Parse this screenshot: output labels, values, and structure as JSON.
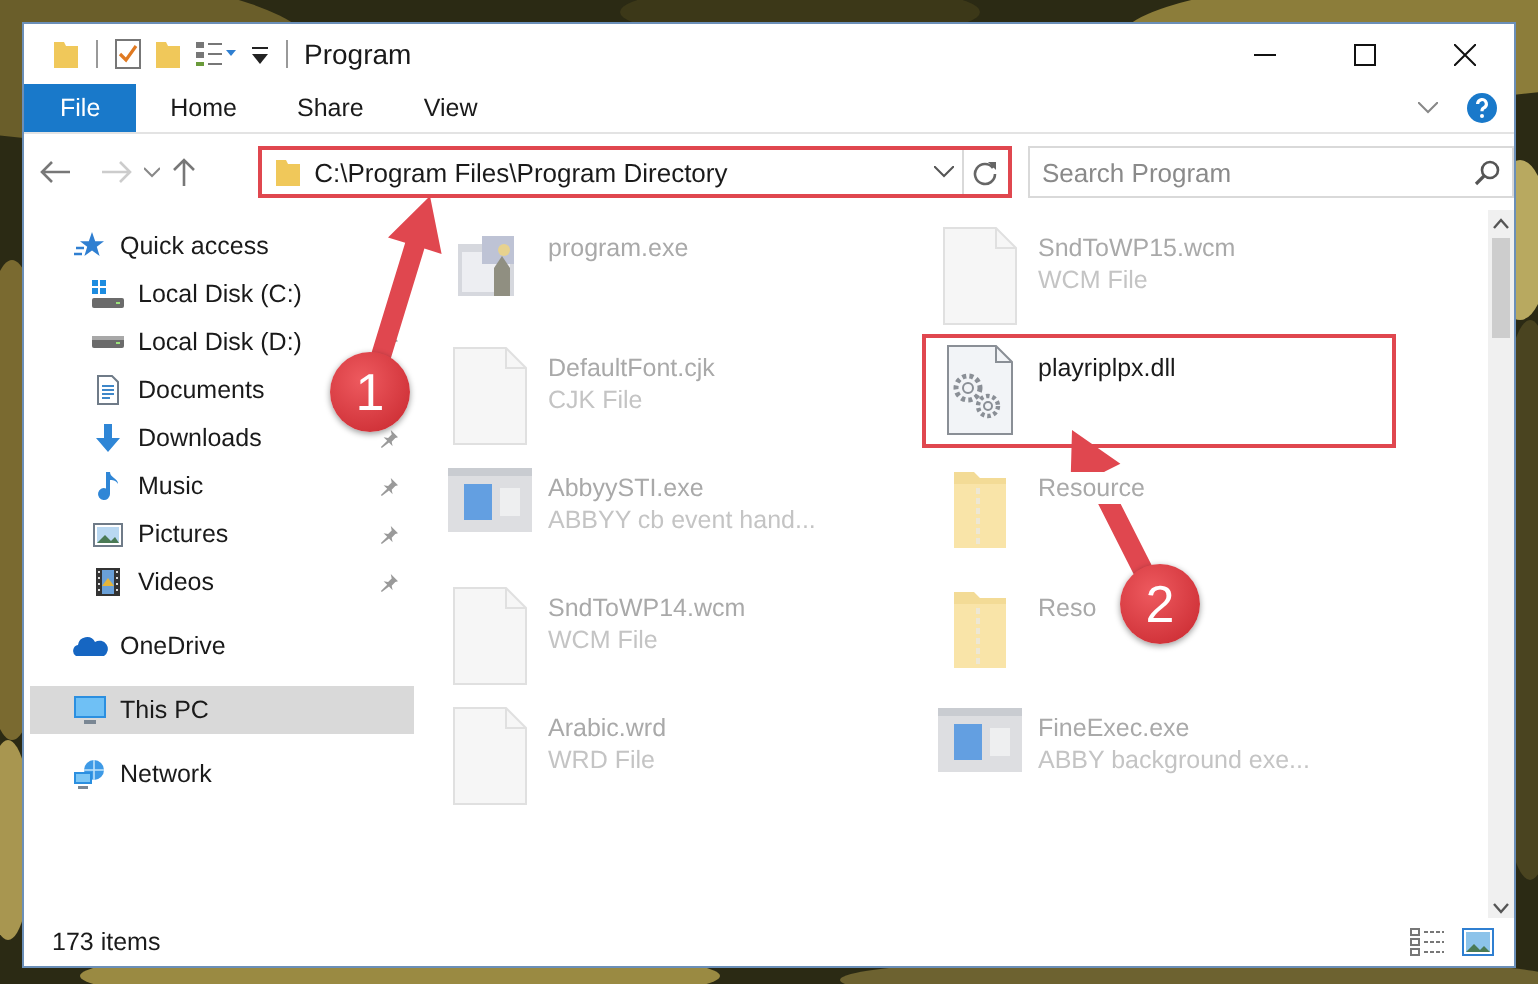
{
  "window": {
    "title": "Program"
  },
  "ribbon_tabs": [
    {
      "label": "File",
      "kind": "file"
    },
    {
      "label": "Home",
      "kind": "tab"
    },
    {
      "label": "Share",
      "kind": "tab"
    },
    {
      "label": "View",
      "kind": "tab"
    }
  ],
  "address_bar": {
    "value": "C:\\Program Files\\Program Directory",
    "highlighted": true
  },
  "search": {
    "placeholder": "Search Program"
  },
  "navigation": [
    {
      "label": "Quick access",
      "kind": "star",
      "selected": false,
      "pinned": false,
      "children": [
        {
          "label": "Local Disk (C:)",
          "kind": "systemdrive",
          "selected": false,
          "pinned": false
        },
        {
          "label": "Local Disk (D:)",
          "kind": "drive",
          "selected": false,
          "pinned": true
        },
        {
          "label": "Documents",
          "kind": "documents",
          "selected": false,
          "pinned": false
        },
        {
          "label": "Downloads",
          "kind": "downloads",
          "selected": false,
          "pinned": true
        },
        {
          "label": "Music",
          "kind": "music",
          "selected": false,
          "pinned": true
        },
        {
          "label": "Pictures",
          "kind": "pictures",
          "selected": false,
          "pinned": true
        },
        {
          "label": "Videos",
          "kind": "videos",
          "selected": false,
          "pinned": true
        }
      ]
    },
    {
      "label": "OneDrive",
      "kind": "cloud",
      "selected": false,
      "pinned": false
    },
    {
      "label": "This PC",
      "kind": "computer",
      "selected": true,
      "pinned": false
    },
    {
      "label": "Network",
      "kind": "network",
      "selected": false,
      "pinned": false
    }
  ],
  "files": [
    {
      "name": "program.exe",
      "kind": "installer",
      "highlighted": false
    },
    {
      "name": "SndToWP15.wcm",
      "type": "WCM File",
      "kind": "document",
      "highlighted": false
    },
    {
      "name": "DefaultFont.cjk",
      "type": "CJK File",
      "kind": "document",
      "highlighted": false
    },
    {
      "name": "playriplpx.dll",
      "kind": "library",
      "highlighted": true
    },
    {
      "name": "AbbyySTI.exe",
      "type": "ABBYY cb event hand...",
      "kind": "application",
      "highlighted": false
    },
    {
      "name": "Resource",
      "kind": "folder",
      "highlighted": false
    },
    {
      "name": "SndToWP14.wcm",
      "type": "WCM File",
      "kind": "document",
      "highlighted": false
    },
    {
      "name": "Reso",
      "kind": "folder",
      "highlighted": false
    },
    {
      "name": "Arabic.wrd",
      "type": "WRD File",
      "kind": "document",
      "highlighted": false
    },
    {
      "name": "FineExec.exe",
      "type": "ABBY background exe...",
      "kind": "application",
      "highlighted": false
    }
  ],
  "annotations": [
    {
      "label": "1"
    },
    {
      "label": "2"
    }
  ],
  "status_bar": {
    "item_count": "173 items"
  }
}
